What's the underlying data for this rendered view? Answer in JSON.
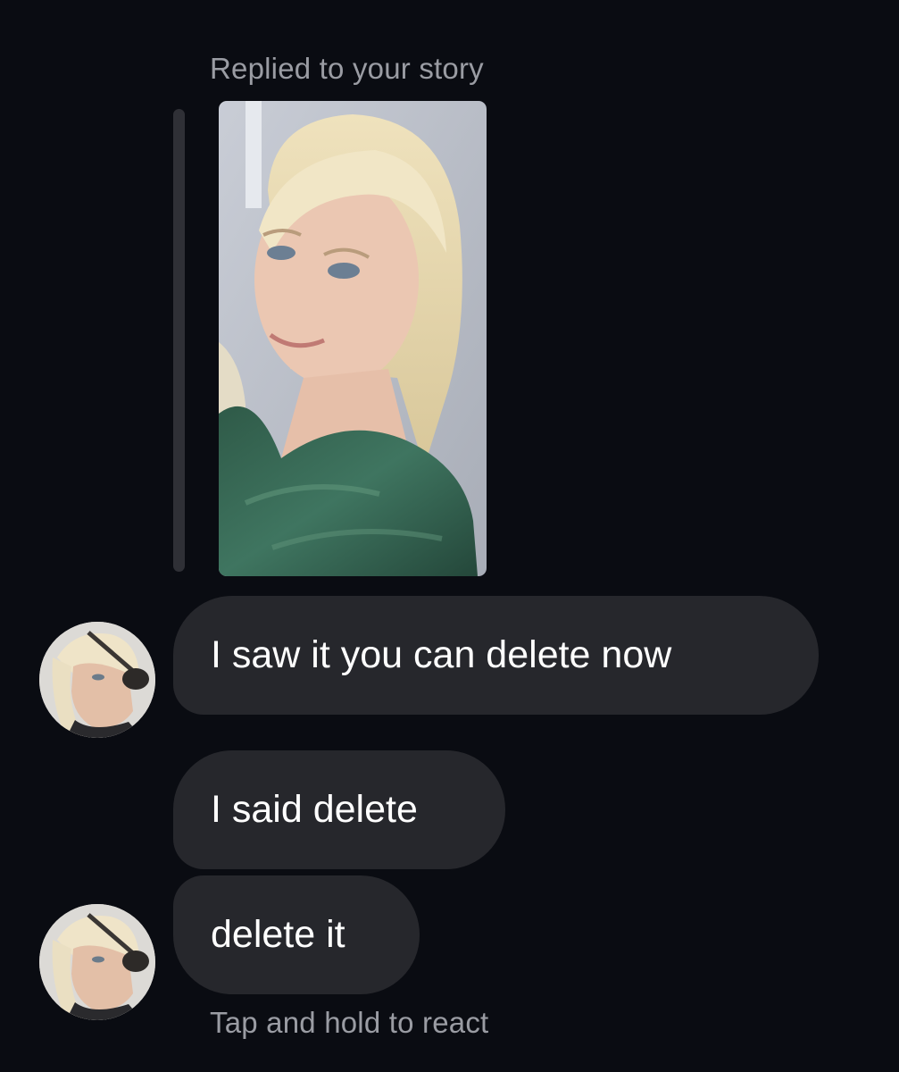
{
  "story_reply": {
    "label": "Replied to your story"
  },
  "messages": [
    {
      "text": "I saw it you can delete now"
    },
    {
      "text": "I said delete"
    },
    {
      "text": "delete it"
    }
  ],
  "footer": {
    "hint": "Tap and hold to react"
  },
  "colors": {
    "background": "#0a0c12",
    "bubble": "#26272c",
    "muted_text": "#9a9ca3",
    "message_text": "#ffffff"
  }
}
